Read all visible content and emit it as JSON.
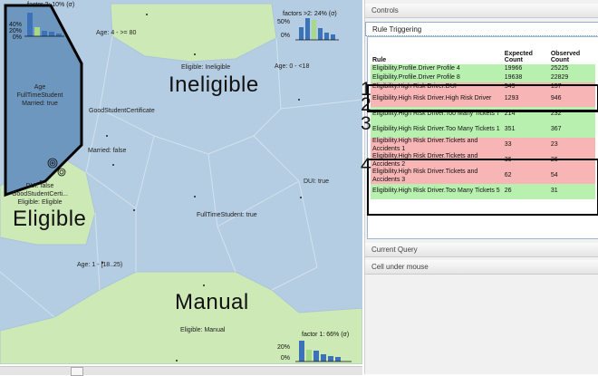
{
  "map": {
    "regions": {
      "ineligible": "Ineligible",
      "eligible": "Eligible",
      "manual": "Manual"
    },
    "labels": {
      "age_gte80": "Age: 4 - >= 80",
      "eligible_ineligible": "Eligible: Ineligible",
      "age_0_18": "Age: 0 - <18",
      "good_student": "GoodStudentCertificate",
      "married_false": "Married: false",
      "dui_true": "DUI: true",
      "fulltime_true": "FullTimeStudent: true",
      "age_18_25": "Age: 1 - [18..25)",
      "eligible_manual": "Eligible: Manual",
      "cluster_age": "Age",
      "cluster_fulltime": "FullTimeStudent",
      "cluster_married": "Married: true",
      "dui_false": "DUI: false",
      "goodstudent_trunc": "GoodStudentCerti...",
      "eligible_eligible": "Eligible: Eligible"
    },
    "insets": {
      "factor2": {
        "title": "factor 2: 10% (σ)",
        "ticks": [
          "40%",
          "20%",
          "0%"
        ]
      },
      "factors_gt2": {
        "title": "factors >2: 24% (σ)",
        "ticks": [
          "50%",
          "0%"
        ]
      },
      "factor1": {
        "title": "factor 1: 66% (σ)",
        "ticks": [
          "20%",
          "0%"
        ]
      }
    },
    "colors": {
      "background_region": "#b5cde2",
      "eligible_region": "#cde9b6",
      "selected_region": "#6e97bf",
      "bar_blue": "#3b72b8",
      "bar_green": "#a8d88a"
    }
  },
  "panel": {
    "sections": {
      "controls": "Controls",
      "rule_triggering": "Rule Triggering",
      "current_query": "Current Query",
      "cell_under_mouse": "Cell under mouse"
    },
    "table": {
      "headers": {
        "rule": "Rule",
        "expected": "Expected Count",
        "observed": "Observed Count"
      },
      "rows": [
        {
          "rule": "Eligibility.Profile.Driver Profile 4",
          "expected": "19966",
          "observed": "25225",
          "status": "green"
        },
        {
          "rule": "Eligibility.Profile.Driver Profile 8",
          "expected": "19638",
          "observed": "22829",
          "status": "green"
        },
        {
          "rule": "Eligibility.High Risk Driver.DUI",
          "expected": "549",
          "observed": "157",
          "status": "red"
        },
        {
          "rule": "Eligibility.High Risk Driver.High Risk Driver",
          "expected": "1293",
          "observed": "946",
          "status": "red"
        },
        {
          "rule": "Eligibility.High Risk Driver.Too Many Tickets 7",
          "expected": "214",
          "observed": "232",
          "status": "green"
        },
        {
          "rule": "Eligibility.High Risk Driver.Too Many Tickets 1",
          "expected": "351",
          "observed": "367",
          "status": "green"
        },
        {
          "rule": "Eligibility.High Risk Driver.Tickets and Accidents 1",
          "expected": "33",
          "observed": "23",
          "status": "red"
        },
        {
          "rule": "Eligibility.High Risk Driver.Tickets and Accidents 2",
          "expected": "36",
          "observed": "26",
          "status": "red"
        },
        {
          "rule": "Eligibility.High Risk Driver.Tickets and Accidents 3",
          "expected": "62",
          "observed": "54",
          "status": "red"
        },
        {
          "rule": "Eligibility.High Risk Driver.Too Many Tickets 5",
          "expected": "26",
          "observed": "31",
          "status": "green"
        }
      ],
      "colors": {
        "green": "#b8f0b0",
        "red": "#f8b5b5"
      }
    },
    "annotations": [
      "1",
      "2",
      "3",
      "4"
    ]
  }
}
